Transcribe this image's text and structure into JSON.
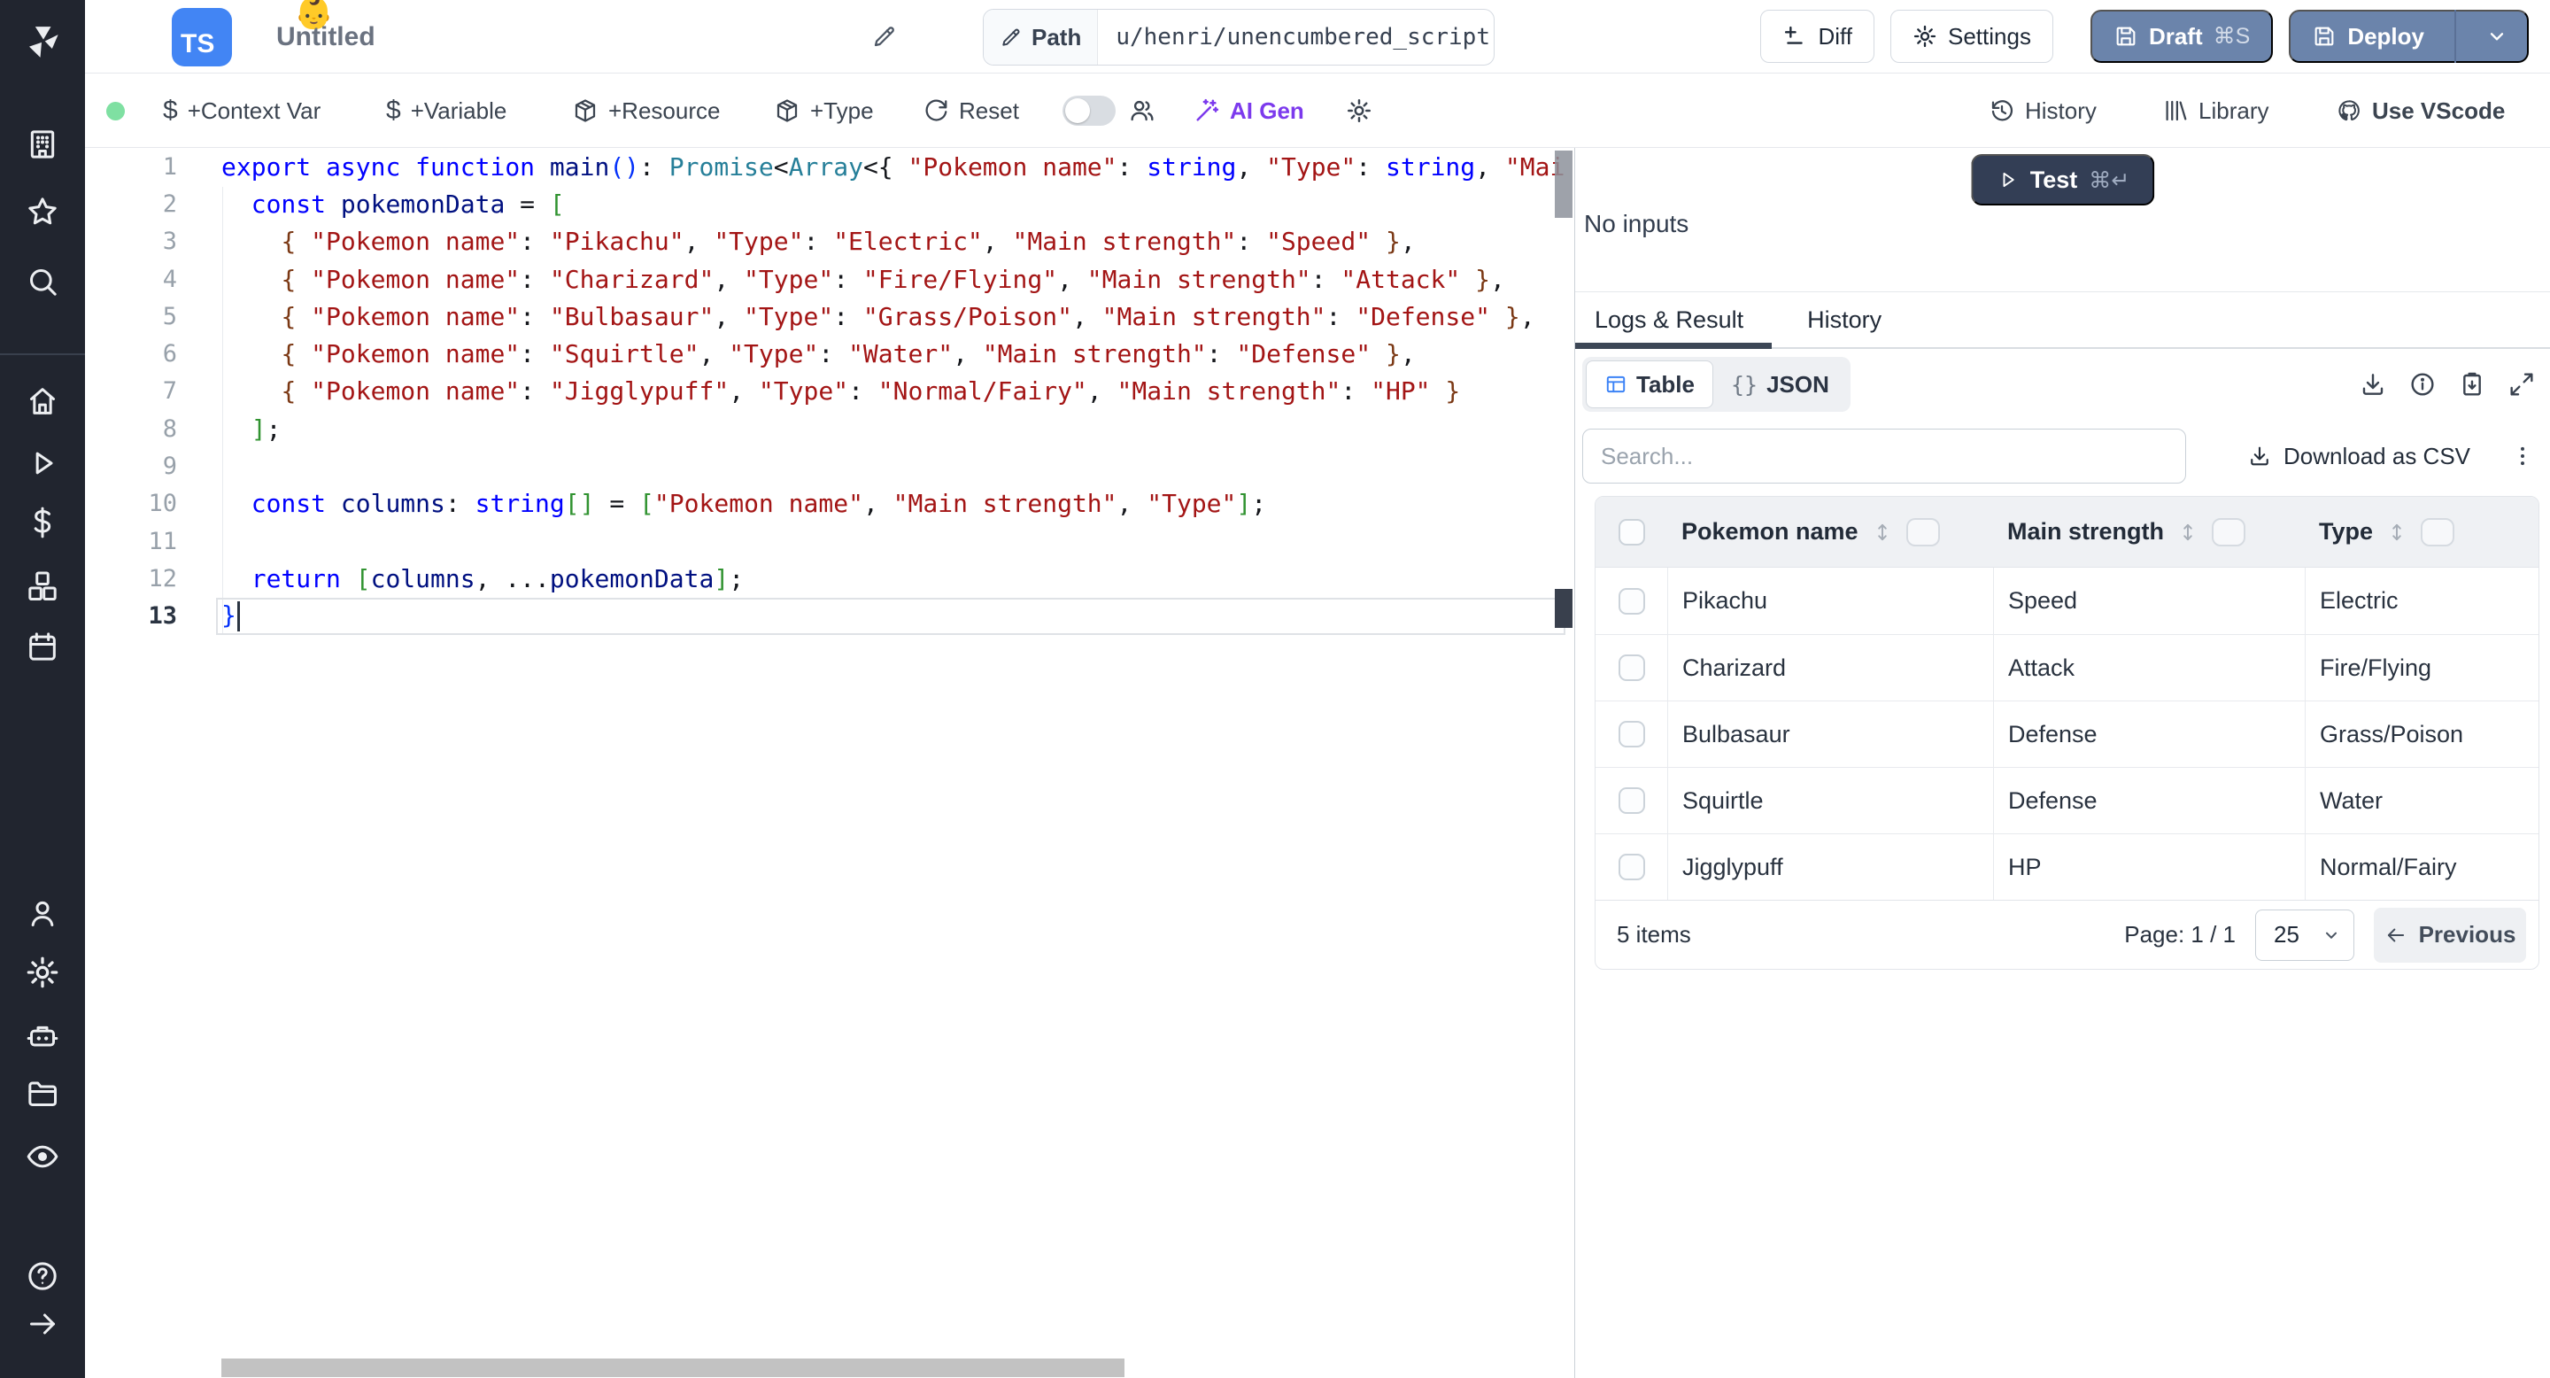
{
  "topbar": {
    "file_type": "TS",
    "file_emoji": "👶",
    "title": "Untitled",
    "path_label": "Path",
    "path_value": "u/henri/unencumbered_script",
    "diff_label": "Diff",
    "settings_label": "Settings",
    "draft_label": "Draft",
    "draft_kbd": "⌘S",
    "deploy_label": "Deploy"
  },
  "toolbar": {
    "context_var": "+Context Var",
    "variable": "+Variable",
    "resource": "+Resource",
    "type": "+Type",
    "reset": "Reset",
    "ai_gen": "AI Gen",
    "history": "History",
    "library": "Library",
    "vscode": "Use VScode",
    "dollar_glyph": "$",
    "status_color": "#7fe0a2"
  },
  "sidebar": {
    "icons": [
      {
        "name": "windmill-logo"
      },
      {
        "name": "building-icon"
      },
      {
        "name": "star-icon"
      },
      {
        "name": "search-icon"
      },
      {
        "name": "home-icon"
      },
      {
        "name": "play-icon"
      },
      {
        "name": "dollar-icon"
      },
      {
        "name": "cubes-icon"
      },
      {
        "name": "calendar-icon"
      },
      {
        "name": "user-icon"
      },
      {
        "name": "gear-icon"
      },
      {
        "name": "robot-icon"
      },
      {
        "name": "folder-icon"
      },
      {
        "name": "eye-icon"
      },
      {
        "name": "help-icon"
      },
      {
        "name": "arrow-right-icon"
      }
    ]
  },
  "editor": {
    "language": "typescript",
    "lines": [
      {
        "n": 1,
        "tokens": [
          {
            "t": "export",
            "c": "k"
          },
          {
            "t": " ",
            "c": "d"
          },
          {
            "t": "async",
            "c": "k"
          },
          {
            "t": " ",
            "c": "d"
          },
          {
            "t": "function",
            "c": "k"
          },
          {
            "t": " ",
            "c": "d"
          },
          {
            "t": "main",
            "c": "v"
          },
          {
            "t": "()",
            "c": "b1"
          },
          {
            "t": ": ",
            "c": "d"
          },
          {
            "t": "Promise",
            "c": "t"
          },
          {
            "t": "<",
            "c": "d"
          },
          {
            "t": "Array",
            "c": "t"
          },
          {
            "t": "<{ ",
            "c": "d"
          },
          {
            "t": "\"Pokemon name\"",
            "c": "s"
          },
          {
            "t": ": ",
            "c": "d"
          },
          {
            "t": "string",
            "c": "k"
          },
          {
            "t": ", ",
            "c": "d"
          },
          {
            "t": "\"Type\"",
            "c": "s"
          },
          {
            "t": ": ",
            "c": "d"
          },
          {
            "t": "string",
            "c": "k"
          },
          {
            "t": ", ",
            "c": "d"
          },
          {
            "t": "\"Mai",
            "c": "s"
          }
        ]
      },
      {
        "n": 2,
        "tokens": [
          {
            "t": "  ",
            "c": "d"
          },
          {
            "t": "const",
            "c": "k"
          },
          {
            "t": " ",
            "c": "d"
          },
          {
            "t": "pokemonData",
            "c": "v"
          },
          {
            "t": " = ",
            "c": "d"
          },
          {
            "t": "[",
            "c": "b2"
          }
        ]
      },
      {
        "n": 3,
        "tokens": [
          {
            "t": "    ",
            "c": "d"
          },
          {
            "t": "{ ",
            "c": "b3"
          },
          {
            "t": "\"Pokemon name\"",
            "c": "s"
          },
          {
            "t": ": ",
            "c": "d"
          },
          {
            "t": "\"Pikachu\"",
            "c": "s"
          },
          {
            "t": ", ",
            "c": "d"
          },
          {
            "t": "\"Type\"",
            "c": "s"
          },
          {
            "t": ": ",
            "c": "d"
          },
          {
            "t": "\"Electric\"",
            "c": "s"
          },
          {
            "t": ", ",
            "c": "d"
          },
          {
            "t": "\"Main strength\"",
            "c": "s"
          },
          {
            "t": ": ",
            "c": "d"
          },
          {
            "t": "\"Speed\"",
            "c": "s"
          },
          {
            "t": " }",
            "c": "b3"
          },
          {
            "t": ",",
            "c": "d"
          }
        ]
      },
      {
        "n": 4,
        "tokens": [
          {
            "t": "    ",
            "c": "d"
          },
          {
            "t": "{ ",
            "c": "b3"
          },
          {
            "t": "\"Pokemon name\"",
            "c": "s"
          },
          {
            "t": ": ",
            "c": "d"
          },
          {
            "t": "\"Charizard\"",
            "c": "s"
          },
          {
            "t": ", ",
            "c": "d"
          },
          {
            "t": "\"Type\"",
            "c": "s"
          },
          {
            "t": ": ",
            "c": "d"
          },
          {
            "t": "\"Fire/Flying\"",
            "c": "s"
          },
          {
            "t": ", ",
            "c": "d"
          },
          {
            "t": "\"Main strength\"",
            "c": "s"
          },
          {
            "t": ": ",
            "c": "d"
          },
          {
            "t": "\"Attack\"",
            "c": "s"
          },
          {
            "t": " }",
            "c": "b3"
          },
          {
            "t": ",",
            "c": "d"
          }
        ]
      },
      {
        "n": 5,
        "tokens": [
          {
            "t": "    ",
            "c": "d"
          },
          {
            "t": "{ ",
            "c": "b3"
          },
          {
            "t": "\"Pokemon name\"",
            "c": "s"
          },
          {
            "t": ": ",
            "c": "d"
          },
          {
            "t": "\"Bulbasaur\"",
            "c": "s"
          },
          {
            "t": ", ",
            "c": "d"
          },
          {
            "t": "\"Type\"",
            "c": "s"
          },
          {
            "t": ": ",
            "c": "d"
          },
          {
            "t": "\"Grass/Poison\"",
            "c": "s"
          },
          {
            "t": ", ",
            "c": "d"
          },
          {
            "t": "\"Main strength\"",
            "c": "s"
          },
          {
            "t": ": ",
            "c": "d"
          },
          {
            "t": "\"Defense\"",
            "c": "s"
          },
          {
            "t": " }",
            "c": "b3"
          },
          {
            "t": ",",
            "c": "d"
          }
        ]
      },
      {
        "n": 6,
        "tokens": [
          {
            "t": "    ",
            "c": "d"
          },
          {
            "t": "{ ",
            "c": "b3"
          },
          {
            "t": "\"Pokemon name\"",
            "c": "s"
          },
          {
            "t": ": ",
            "c": "d"
          },
          {
            "t": "\"Squirtle\"",
            "c": "s"
          },
          {
            "t": ", ",
            "c": "d"
          },
          {
            "t": "\"Type\"",
            "c": "s"
          },
          {
            "t": ": ",
            "c": "d"
          },
          {
            "t": "\"Water\"",
            "c": "s"
          },
          {
            "t": ", ",
            "c": "d"
          },
          {
            "t": "\"Main strength\"",
            "c": "s"
          },
          {
            "t": ": ",
            "c": "d"
          },
          {
            "t": "\"Defense\"",
            "c": "s"
          },
          {
            "t": " }",
            "c": "b3"
          },
          {
            "t": ",",
            "c": "d"
          }
        ]
      },
      {
        "n": 7,
        "tokens": [
          {
            "t": "    ",
            "c": "d"
          },
          {
            "t": "{ ",
            "c": "b3"
          },
          {
            "t": "\"Pokemon name\"",
            "c": "s"
          },
          {
            "t": ": ",
            "c": "d"
          },
          {
            "t": "\"Jigglypuff\"",
            "c": "s"
          },
          {
            "t": ", ",
            "c": "d"
          },
          {
            "t": "\"Type\"",
            "c": "s"
          },
          {
            "t": ": ",
            "c": "d"
          },
          {
            "t": "\"Normal/Fairy\"",
            "c": "s"
          },
          {
            "t": ", ",
            "c": "d"
          },
          {
            "t": "\"Main strength\"",
            "c": "s"
          },
          {
            "t": ": ",
            "c": "d"
          },
          {
            "t": "\"HP\"",
            "c": "s"
          },
          {
            "t": " }",
            "c": "b3"
          }
        ]
      },
      {
        "n": 8,
        "tokens": [
          {
            "t": "  ",
            "c": "d"
          },
          {
            "t": "]",
            "c": "b2"
          },
          {
            "t": ";",
            "c": "d"
          }
        ]
      },
      {
        "n": 9,
        "tokens": []
      },
      {
        "n": 10,
        "tokens": [
          {
            "t": "  ",
            "c": "d"
          },
          {
            "t": "const",
            "c": "k"
          },
          {
            "t": " ",
            "c": "d"
          },
          {
            "t": "columns",
            "c": "v"
          },
          {
            "t": ": ",
            "c": "d"
          },
          {
            "t": "string",
            "c": "k"
          },
          {
            "t": "[]",
            "c": "b2"
          },
          {
            "t": " = ",
            "c": "d"
          },
          {
            "t": "[",
            "c": "b2"
          },
          {
            "t": "\"Pokemon name\"",
            "c": "s"
          },
          {
            "t": ", ",
            "c": "d"
          },
          {
            "t": "\"Main strength\"",
            "c": "s"
          },
          {
            "t": ", ",
            "c": "d"
          },
          {
            "t": "\"Type\"",
            "c": "s"
          },
          {
            "t": "]",
            "c": "b2"
          },
          {
            "t": ";",
            "c": "d"
          }
        ]
      },
      {
        "n": 11,
        "tokens": []
      },
      {
        "n": 12,
        "tokens": [
          {
            "t": "  ",
            "c": "d"
          },
          {
            "t": "return",
            "c": "k"
          },
          {
            "t": " ",
            "c": "d"
          },
          {
            "t": "[",
            "c": "b2"
          },
          {
            "t": "columns",
            "c": "v"
          },
          {
            "t": ", ...",
            "c": "d"
          },
          {
            "t": "pokemonData",
            "c": "v"
          },
          {
            "t": "]",
            "c": "b2"
          },
          {
            "t": ";",
            "c": "d"
          }
        ]
      },
      {
        "n": 13,
        "active": true,
        "tokens": [
          {
            "t": "}",
            "c": "b1"
          }
        ]
      }
    ]
  },
  "run_panel": {
    "test_label": "Test",
    "test_kbd": "⌘↵",
    "no_inputs": "No inputs",
    "tabs": [
      "Logs & Result",
      "History"
    ],
    "view_toggle": {
      "table": "Table",
      "json": "JSON",
      "braces_glyph": "{}"
    },
    "search_placeholder": "Search...",
    "download_csv": "Download as CSV"
  },
  "result_table": {
    "columns": [
      "Pokemon name",
      "Main strength",
      "Type"
    ],
    "rows": [
      [
        "Pikachu",
        "Speed",
        "Electric"
      ],
      [
        "Charizard",
        "Attack",
        "Fire/Flying"
      ],
      [
        "Bulbasaur",
        "Defense",
        "Grass/Poison"
      ],
      [
        "Squirtle",
        "Defense",
        "Water"
      ],
      [
        "Jigglypuff",
        "HP",
        "Normal/Fairy"
      ]
    ],
    "footer": {
      "items": "5 items",
      "page": "Page: 1 / 1",
      "page_size": "25",
      "previous": "Previous"
    }
  },
  "colors": {
    "sidebar_bg": "#21252f",
    "accent_blue": "#3b82f6",
    "button_slate_blue": "#6b84ab",
    "test_navy": "#333e55",
    "ai_purple": "#7c3aed",
    "status_green": "#7fe0a2",
    "code_keyword": "#0000ff",
    "code_string": "#a31515",
    "code_type": "#267f99"
  }
}
